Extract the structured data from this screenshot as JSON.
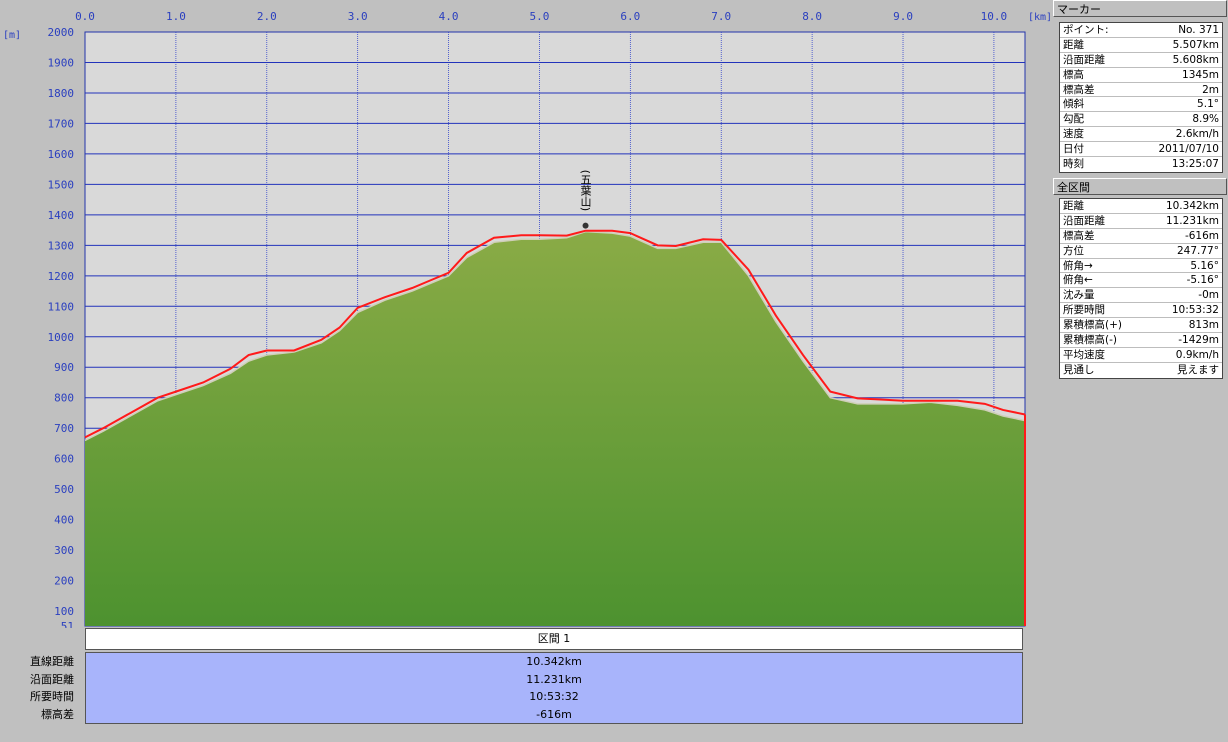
{
  "chart_data": {
    "type": "area",
    "xlabel": "[km]",
    "ylabel": "[m]",
    "xlim": [
      0,
      10.342
    ],
    "ylim": [
      51,
      2000
    ],
    "x_ticks": [
      "0.0",
      "1.0",
      "2.0",
      "3.0",
      "4.0",
      "5.0",
      "6.0",
      "7.0",
      "8.0",
      "9.0",
      "10.0"
    ],
    "y_ticks": [
      "2000",
      "1900",
      "1800",
      "1700",
      "1600",
      "1500",
      "1400",
      "1300",
      "1200",
      "1100",
      "1000",
      "900",
      "800",
      "700",
      "600",
      "500",
      "400",
      "300",
      "200",
      "100",
      "51"
    ],
    "grid": true,
    "series": [
      {
        "x": [
          0,
          0.2,
          0.5,
          0.8,
          1.0,
          1.3,
          1.6,
          1.8,
          2.0,
          2.3,
          2.6,
          2.8,
          3.0,
          3.3,
          3.6,
          3.8,
          4.0,
          4.2,
          4.5,
          4.8,
          5.0,
          5.3,
          5.507,
          5.8,
          6.0,
          6.3,
          6.5,
          6.8,
          7.0,
          7.3,
          7.6,
          7.9,
          8.2,
          8.5,
          8.7,
          9.0,
          9.3,
          9.6,
          9.9,
          10.1,
          10.342
        ],
        "y": [
          660,
          690,
          740,
          790,
          810,
          840,
          880,
          920,
          940,
          950,
          980,
          1020,
          1080,
          1120,
          1150,
          1175,
          1200,
          1260,
          1310,
          1320,
          1320,
          1325,
          1345,
          1340,
          1330,
          1290,
          1290,
          1310,
          1310,
          1200,
          1050,
          920,
          800,
          780,
          780,
          780,
          785,
          775,
          760,
          740,
          725
        ]
      },
      {
        "x": [
          0,
          0.2,
          0.5,
          0.8,
          1.0,
          1.3,
          1.6,
          1.8,
          2.0,
          2.3,
          2.6,
          2.8,
          3.0,
          3.3,
          3.6,
          3.8,
          4.0,
          4.2,
          4.5,
          4.8,
          5.0,
          5.3,
          5.507,
          5.8,
          6.0,
          6.3,
          6.5,
          6.8,
          7.0,
          7.3,
          7.6,
          7.9,
          8.2,
          8.5,
          8.7,
          9.0,
          9.3,
          9.6,
          9.9,
          10.1,
          10.342
        ],
        "y": [
          670,
          700,
          750,
          800,
          820,
          850,
          895,
          940,
          955,
          955,
          990,
          1030,
          1095,
          1130,
          1160,
          1185,
          1210,
          1275,
          1325,
          1333,
          1333,
          1332,
          1348,
          1348,
          1340,
          1300,
          1298,
          1320,
          1318,
          1220,
          1070,
          940,
          820,
          798,
          795,
          790,
          790,
          790,
          780,
          760,
          745
        ]
      }
    ],
    "marker": {
      "label": "(五葉山)",
      "x": 5.507,
      "y": 1345
    }
  },
  "marker_panel": {
    "title": "マーカー",
    "rows": [
      {
        "k": "ポイント:",
        "v": "No. 371"
      },
      {
        "k": "距離",
        "v": "5.507km"
      },
      {
        "k": "沿面距離",
        "v": "5.608km"
      },
      {
        "k": "標高",
        "v": "1345m"
      },
      {
        "k": "標高差",
        "v": "2m"
      },
      {
        "k": "傾斜",
        "v": "5.1°"
      },
      {
        "k": "勾配",
        "v": "8.9%"
      },
      {
        "k": "速度",
        "v": "2.6km/h"
      },
      {
        "k": "日付",
        "v": "2011/07/10"
      },
      {
        "k": "時刻",
        "v": "13:25:07"
      }
    ]
  },
  "all_panel": {
    "title": "全区間",
    "rows": [
      {
        "k": "距離",
        "v": "10.342km"
      },
      {
        "k": "沿面距離",
        "v": "11.231km"
      },
      {
        "k": "標高差",
        "v": "-616m"
      },
      {
        "k": "方位",
        "v": "247.77°"
      },
      {
        "k": "俯角→",
        "v": "5.16°"
      },
      {
        "k": "俯角←",
        "v": "-5.16°"
      },
      {
        "k": "沈み量",
        "v": "-0m"
      },
      {
        "k": "所要時間",
        "v": "10:53:32"
      },
      {
        "k": "累積標高(+)",
        "v": "813m"
      },
      {
        "k": "累積標高(-)",
        "v": "-1429m"
      },
      {
        "k": "平均速度",
        "v": "0.9km/h"
      },
      {
        "k": "見通し",
        "v": "見えます"
      }
    ]
  },
  "section": {
    "title": "区間 1",
    "labels": [
      "直線距離",
      "沿面距離",
      "所要時間",
      "標高差"
    ],
    "values": [
      "10.342km",
      "11.231km",
      "10:53:32",
      "-616m"
    ]
  }
}
